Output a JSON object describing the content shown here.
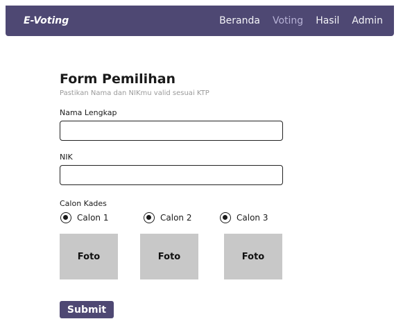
{
  "navbar": {
    "brand": "E-Voting",
    "links": [
      {
        "label": "Beranda",
        "active": false
      },
      {
        "label": "Voting",
        "active": true
      },
      {
        "label": "Hasil",
        "active": false
      },
      {
        "label": "Admin",
        "active": false
      }
    ]
  },
  "form": {
    "title": "Form Pemilihan",
    "subtitle": "Pastikan Nama dan NIKmu valid sesuai KTP",
    "name_label": "Nama Lengkap",
    "name_value": "",
    "nik_label": "NIK",
    "nik_value": "",
    "candidate_label": "Calon Kades",
    "candidates": [
      {
        "label": "Calon 1",
        "photo": "Foto"
      },
      {
        "label": "Calon 2",
        "photo": "Foto"
      },
      {
        "label": "Calon 3",
        "photo": "Foto"
      }
    ],
    "submit_label": "Submit"
  },
  "colors": {
    "navbar": "#4e4873",
    "active_link": "#b7b2d6",
    "photo_placeholder": "#c8c8c8",
    "button": "#4e4873"
  }
}
